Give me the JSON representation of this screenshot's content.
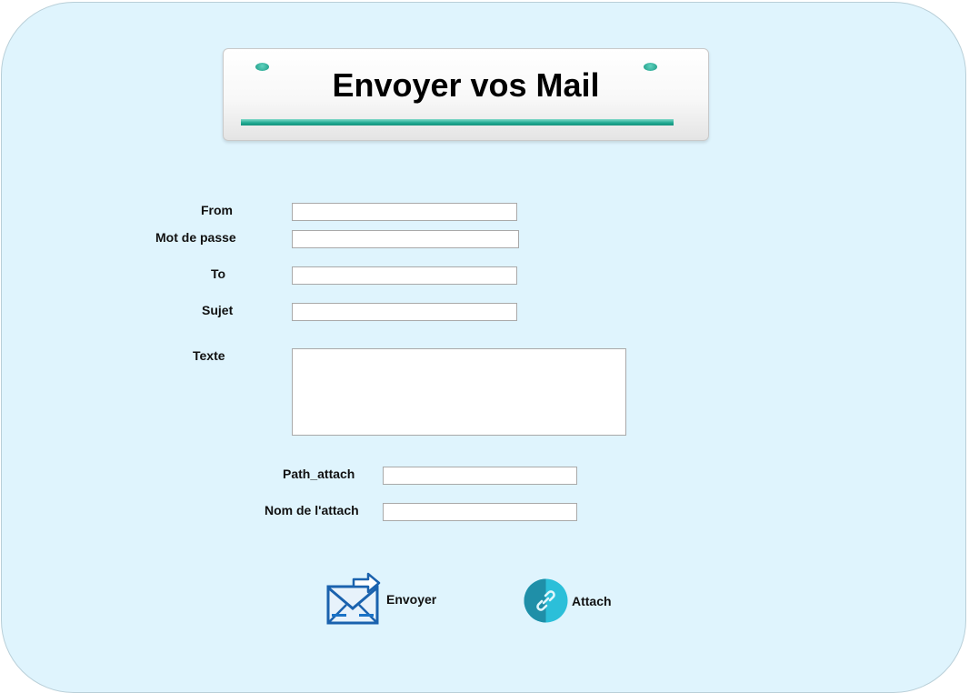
{
  "header": {
    "title": "Envoyer vos Mail"
  },
  "form": {
    "from_label": "From",
    "from_value": "",
    "password_label": "Mot de passe",
    "password_value": "",
    "to_label": "To",
    "to_value": "",
    "subject_label": "Sujet",
    "subject_value": "",
    "body_label": "Texte",
    "body_value": "",
    "path_attach_label": "Path_attach",
    "path_attach_value": "",
    "attach_name_label": "Nom de l'attach",
    "attach_name_value": ""
  },
  "actions": {
    "send_label": "Envoyer",
    "send_icon": "mail-send-icon",
    "attach_label": "Attach",
    "attach_icon": "link-icon"
  },
  "colors": {
    "background": "#dff4fd",
    "accent": "#1ea890",
    "attach_button": "#1fa3c4",
    "mail_icon": "#1a73c7"
  }
}
